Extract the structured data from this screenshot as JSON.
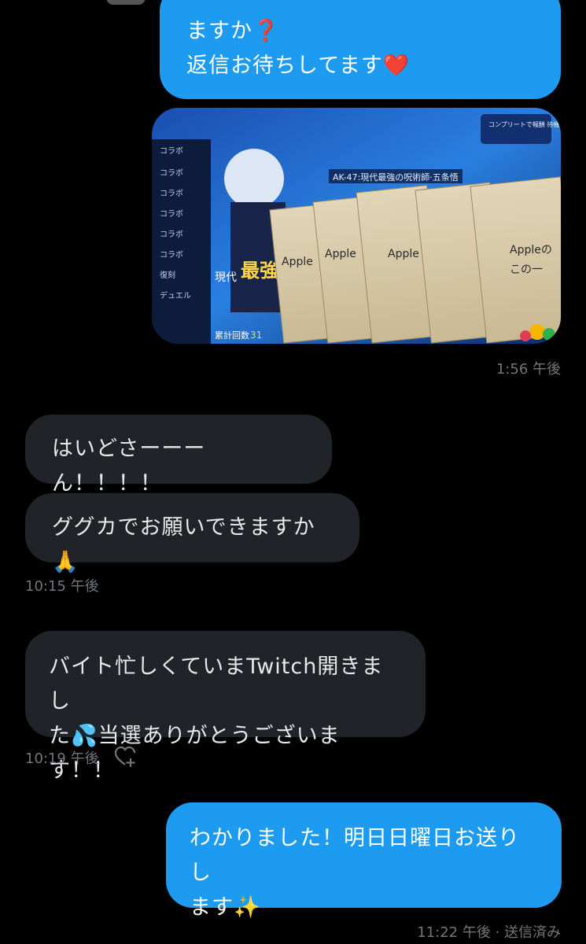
{
  "messages": [
    {
      "id": "m1",
      "direction": "sent",
      "lines": [
        "ますか",
        "返信お待ちしてます"
      ],
      "emoji": [
        "❓",
        "❤️"
      ]
    },
    {
      "id": "m2",
      "direction": "sent",
      "type": "image"
    },
    {
      "id": "t1",
      "time": "1:56 午後"
    },
    {
      "id": "m3",
      "direction": "received",
      "text": "はいどさーーーん！！！！"
    },
    {
      "id": "m4",
      "direction": "received",
      "text": "ググカでお願いできますか🙏"
    },
    {
      "id": "t2",
      "time": "10:15 午後"
    },
    {
      "id": "m5",
      "direction": "received",
      "lines": [
        "バイト忙しくていまTwitch開きまし",
        "た💦当選ありがとうございます！！"
      ]
    },
    {
      "id": "t3",
      "time": "10:19 午後"
    },
    {
      "id": "m6",
      "direction": "sent",
      "lines": [
        "わかりました！明日日曜日お送りし",
        "ます✨"
      ]
    },
    {
      "id": "t4",
      "time": "11:22 午後 · 送信済み"
    }
  ],
  "image_texts": {
    "menu": [
      "コラボ",
      "コラボ",
      "コラボ",
      "コラボ",
      "コラボ",
      "コラボ",
      "復刻",
      "デュエル"
    ],
    "banner": "AK-47:現代最強の呪術師·五条悟",
    "title_small": "現代",
    "title_big": "最強",
    "counter_label": "累計回数",
    "counter_value": "31",
    "notice": "コンプリートで報酬 待機場天空変化",
    "cards": [
      "Apple",
      "Apple",
      "Apple",
      "Appleの",
      "この一"
    ]
  },
  "colors": {
    "sent": "#1d9bf0",
    "received": "#202327",
    "meta": "#71767b",
    "background": "#000000"
  }
}
